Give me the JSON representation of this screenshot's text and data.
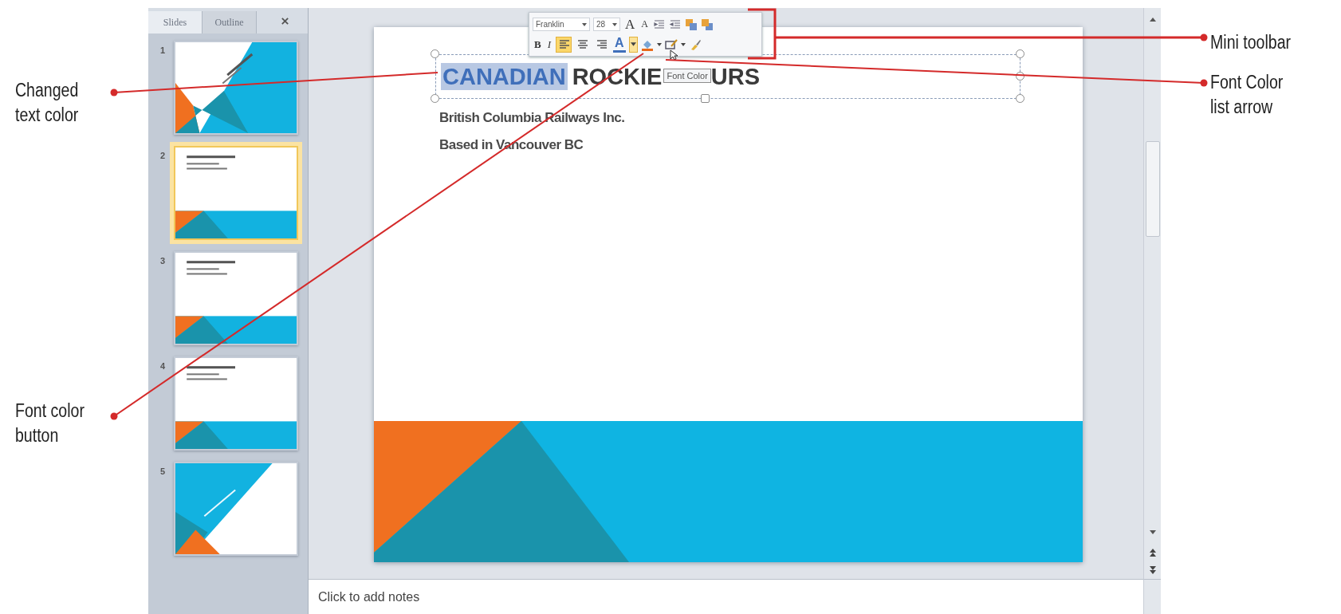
{
  "slides_panel": {
    "tabs": [
      {
        "label": "Slides",
        "selected": true
      },
      {
        "label": "Outline",
        "selected": false
      }
    ],
    "thumbnails": [
      {
        "number": "1",
        "kind": "title_right",
        "selected": false
      },
      {
        "number": "2",
        "kind": "content",
        "selected": true
      },
      {
        "number": "3",
        "kind": "content",
        "selected": false
      },
      {
        "number": "4",
        "kind": "content",
        "selected": false
      },
      {
        "number": "5",
        "kind": "title_left",
        "selected": false
      }
    ]
  },
  "mini_toolbar": {
    "font": "Franklin",
    "size": "28",
    "grow_font": "A",
    "shrink_font": "A",
    "bold": "B",
    "italic": "I",
    "font_color": "A",
    "alignments": [
      {
        "kind": "left",
        "selected": true
      },
      {
        "kind": "center",
        "selected": false
      },
      {
        "kind": "right",
        "selected": false
      }
    ],
    "font_color_arrow_hovered": true
  },
  "tooltip": "Font Color",
  "slide": {
    "title_parts": [
      {
        "text": "CANADIAN",
        "selected": true,
        "color": "#3f6fba"
      },
      {
        "text": "ROCKIE",
        "selected": false,
        "color": "#3a3a3a"
      },
      {
        "text": "URS",
        "selected": false,
        "color": "#3a3a3a"
      }
    ],
    "subtitle": [
      "British Columbia Railways Inc.",
      "Based in Vancouver BC"
    ]
  },
  "notes": {
    "placeholder": "Click to add notes"
  },
  "callouts_left": [
    {
      "text": "Changed\ntext color"
    },
    {
      "text": "Font color\nbutton"
    }
  ],
  "callouts_right": [
    {
      "text": "Mini toolbar"
    },
    {
      "text": "Font Color\nlist arrow"
    }
  ]
}
